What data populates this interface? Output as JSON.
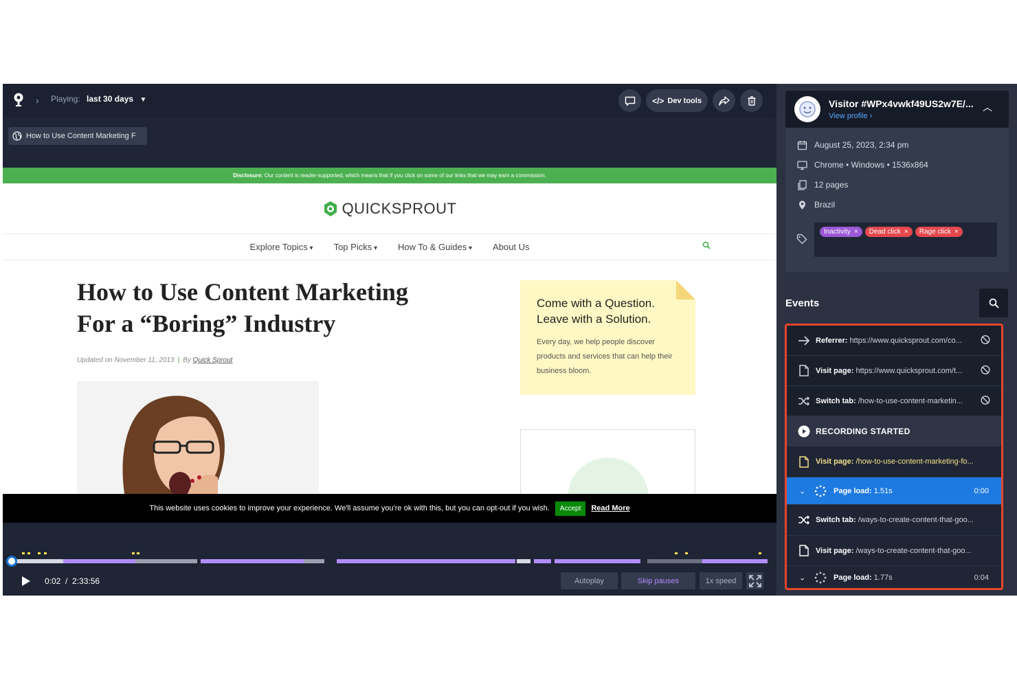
{
  "player": {
    "playing_label": "Playing:",
    "playing_value": "last 30 days",
    "dev_tools_label": "Dev tools",
    "tab_title": "How to Use Content Marketing F"
  },
  "site": {
    "disclosure_bold": "Disclosure:",
    "disclosure_text": "Our content is reader-supported, which means that if you click on some of our links that we may earn a commission.",
    "brand": "QUICKSPROUT",
    "nav": [
      "Explore Topics",
      "Top Picks",
      "How To & Guides",
      "About Us"
    ],
    "headline_line1": "How to Use Content Marketing",
    "headline_line2": "For a “Boring” Industry",
    "byline_updated": "Updated on November 11, 2013",
    "byline_by": "By",
    "byline_author": "Quick Sprout",
    "note_q1": "Come with a Question.",
    "note_q2": "Leave with a Solution.",
    "note_p": "Every day, we help people discover products and services that can help their business bloom.",
    "cookie_text": "This website uses cookies to improve your experience. We'll assume you're ok with this, but you can opt-out if you wish.",
    "cookie_accept": "Accept",
    "cookie_more": "Read More"
  },
  "controls": {
    "current_time": "0:02",
    "separator": "/",
    "total_time": "2:33:56",
    "autoplay": "Autoplay",
    "skip_pauses": "Skip pauses",
    "speed": "1x speed",
    "progress_fraction": 0.002
  },
  "visitor": {
    "name": "Visitor #WPx4vwkf49US2w7E/...",
    "profile_link": "View profile ›",
    "date": "August 25, 2023, 2:34 pm",
    "device": "Chrome • Windows • 1536x864",
    "pages": "12 pages",
    "country": "Brazil",
    "tags": [
      {
        "label": "Inactivity",
        "color": "#9b59d6"
      },
      {
        "label": "Dead click",
        "color": "#e5484d"
      },
      {
        "label": "Rage click",
        "color": "#e5484d"
      }
    ]
  },
  "events": {
    "title": "Events",
    "items": [
      {
        "label": "Referrer:",
        "value": "https://www.quicksprout.com/co...",
        "icon": "arrow-right-icon"
      },
      {
        "label": "Visit page:",
        "value": "https://www.quicksprout.com/t...",
        "icon": "page-icon"
      },
      {
        "label": "Switch tab:",
        "value": "/how-to-use-content-marketin...",
        "icon": "shuffle-icon"
      },
      {
        "label": "RECORDING STARTED",
        "value": "",
        "icon": "play-circle-icon"
      },
      {
        "label": "Visit page:",
        "value": "/how-to-use-content-marketing-fo...",
        "icon": "page-icon"
      },
      {
        "label": "Page load:",
        "value": "1.51s",
        "time": "0:00",
        "icon": "spinner-icon"
      },
      {
        "label": "Switch tab:",
        "value": "/ways-to-create-content-that-goo...",
        "icon": "shuffle-icon"
      },
      {
        "label": "Visit page:",
        "value": "/ways-to-create-content-that-goo...",
        "icon": "page-icon"
      },
      {
        "label": "Page load:",
        "value": "1.77s",
        "time": "0:04",
        "icon": "spinner-icon"
      }
    ]
  },
  "colors": {
    "accent_blue": "#1d7ae0",
    "highlight_border": "#e8452e",
    "brand_green": "#4caf50",
    "timeline_purple": "#b28cff"
  }
}
